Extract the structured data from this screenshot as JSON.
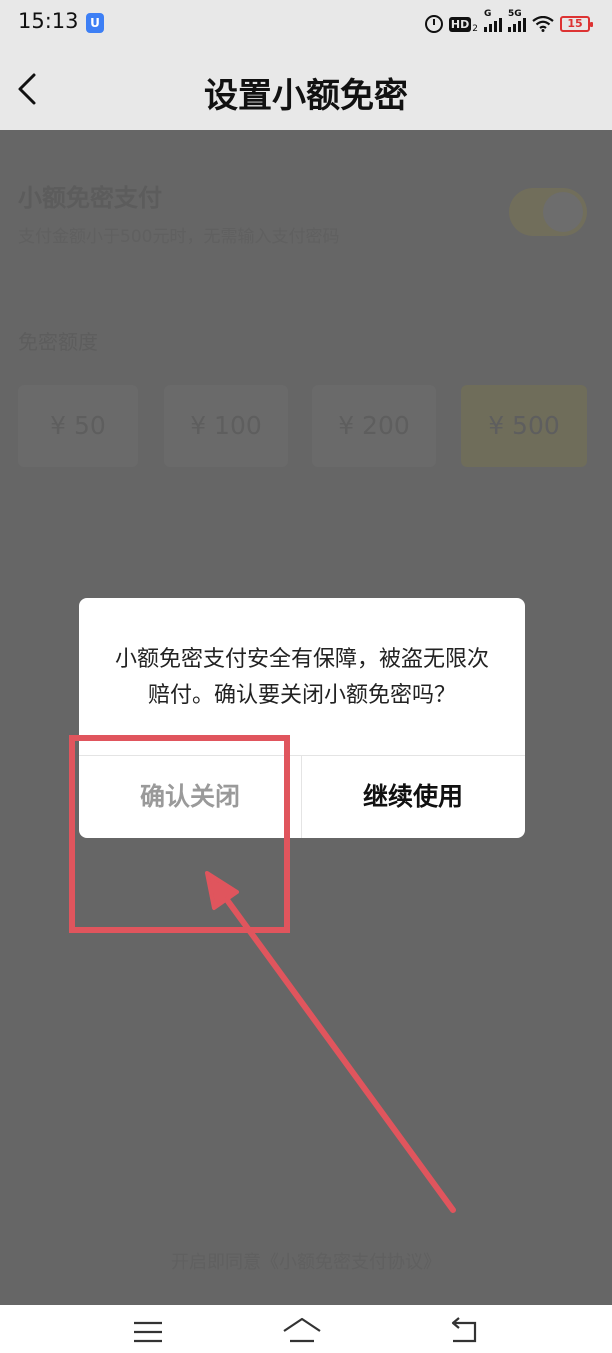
{
  "status_bar": {
    "time": "15:13",
    "app_badge": "U",
    "hd_label": "HD",
    "hd_sub": "2",
    "signal1_tag": "G",
    "signal2_tag": "5G",
    "battery_level": "15"
  },
  "header": {
    "title": "设置小额免密"
  },
  "setting": {
    "title": "小额免密支付",
    "description": "支付金额小于500元时，无需输入支付密码",
    "toggle_on": true
  },
  "limit": {
    "title": "免密额度",
    "options": [
      "¥ 50",
      "¥ 100",
      "¥ 200",
      "¥ 500"
    ],
    "selected": "¥ 500"
  },
  "agreement": {
    "text": "开启即同意《小额免密支付协议》"
  },
  "dialog": {
    "message": "小额免密支付安全有保障，被盗无限次赔付。确认要关闭小额免密吗？",
    "confirm_label": "确认关闭",
    "continue_label": "继续使用"
  },
  "colors": {
    "annotation": "#e0555d",
    "overlay": "#666666",
    "dialog_bg": "#ffffff"
  }
}
